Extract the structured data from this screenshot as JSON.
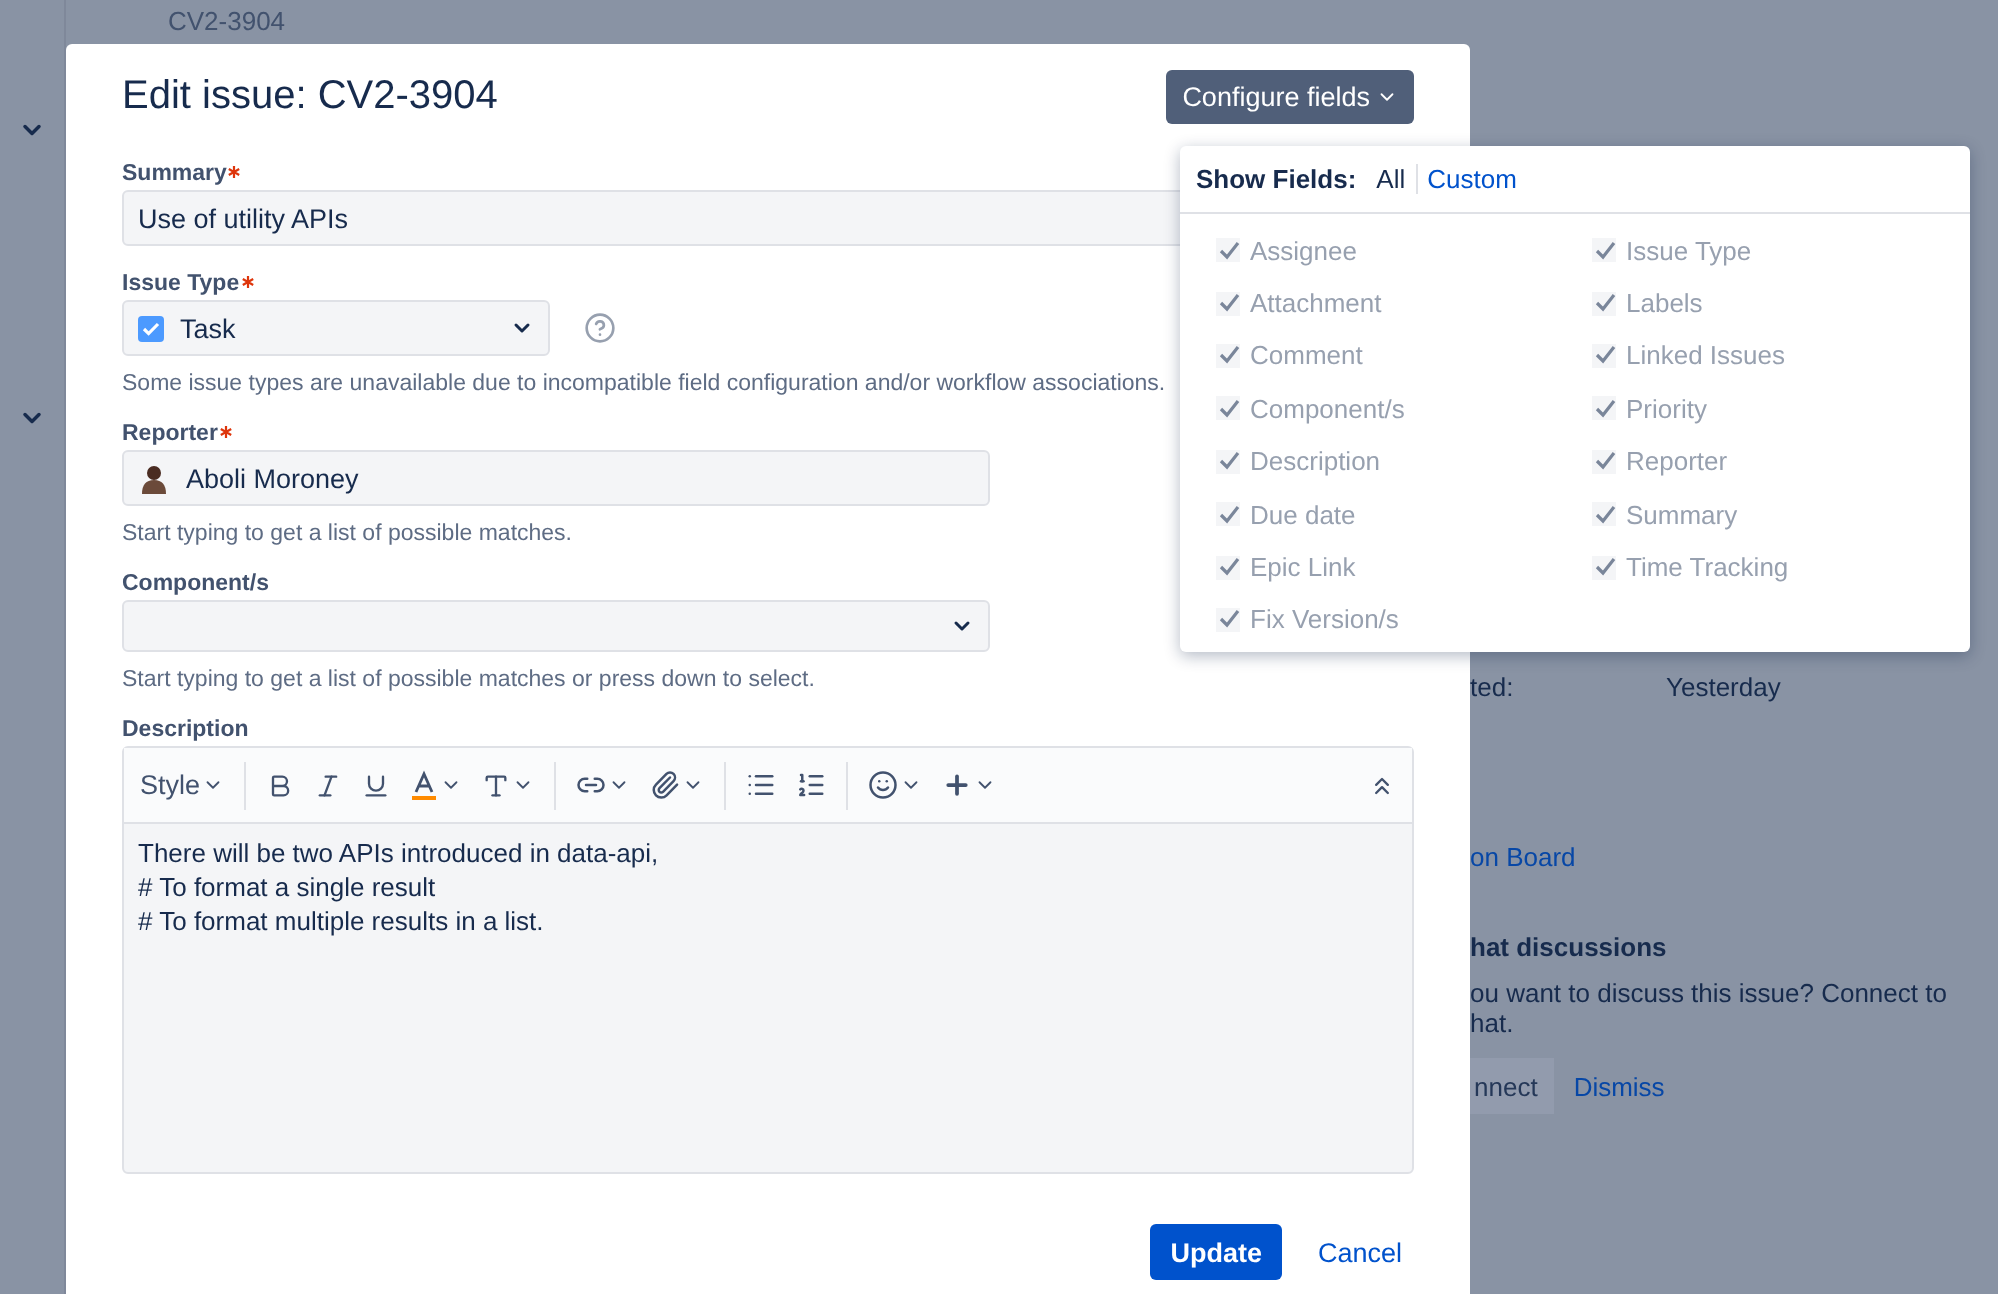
{
  "background": {
    "issue_key": "CV2-3904",
    "created_label": "ted:",
    "created_value": "Yesterday",
    "board_link": "on Board",
    "chat_title": "hat discussions",
    "chat_text": "ou want to discuss this issue? Connect to",
    "chat_text_2": "hat.",
    "connect_button": "nnect",
    "dismiss_link": "Dismiss"
  },
  "dialog": {
    "title": "Edit issue: CV2-3904",
    "configure_button": "Configure fields",
    "fields": [
      {
        "kind": "text",
        "label": "Summary",
        "required": true,
        "value": "Use of utility APIs"
      },
      {
        "kind": "issuetype",
        "label": "Issue Type",
        "required": true,
        "value": "Task",
        "hint": "Some issue types are unavailable due to incompatible field configuration and/or workflow associations."
      },
      {
        "kind": "user",
        "label": "Reporter",
        "required": true,
        "value": "Aboli Moroney",
        "hint": "Start typing to get a list of possible matches."
      },
      {
        "kind": "select",
        "label": "Component/s",
        "required": false,
        "hint": "Start typing to get a list of possible matches or press down to select."
      },
      {
        "kind": "editor",
        "label": "Description",
        "required": false,
        "toolbar_style": "Style",
        "lines": [
          "There will be two APIs introduced in data-api,",
          "# To format a single result",
          "# To format multiple results in a list."
        ]
      }
    ],
    "update_button": "Update",
    "cancel_link": "Cancel"
  },
  "show_fields": {
    "label": "Show Fields:",
    "modes": [
      {
        "label": "All",
        "selected": true
      },
      {
        "label": "Custom",
        "selected": false
      }
    ],
    "columns": [
      [
        {
          "label": "Assignee",
          "checked": true
        },
        {
          "label": "Attachment",
          "checked": true
        },
        {
          "label": "Comment",
          "checked": true
        },
        {
          "label": "Component/s",
          "checked": true
        },
        {
          "label": "Description",
          "checked": true
        },
        {
          "label": "Due date",
          "checked": true
        },
        {
          "label": "Epic Link",
          "checked": true
        },
        {
          "label": "Fix Version/s",
          "checked": true
        }
      ],
      [
        {
          "label": "Issue Type",
          "checked": true
        },
        {
          "label": "Labels",
          "checked": true
        },
        {
          "label": "Linked Issues",
          "checked": true
        },
        {
          "label": "Priority",
          "checked": true
        },
        {
          "label": "Reporter",
          "checked": true
        },
        {
          "label": "Summary",
          "checked": true
        },
        {
          "label": "Time Tracking",
          "checked": true
        }
      ]
    ]
  }
}
